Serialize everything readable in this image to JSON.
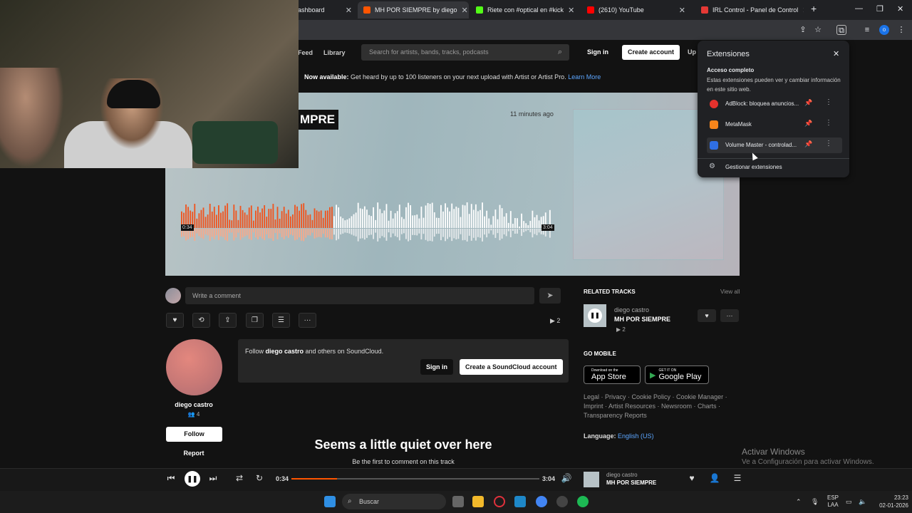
{
  "browser": {
    "tabs": [
      {
        "title": "ashboard",
        "fav": "#4a6ee0"
      },
      {
        "title": "MH POR SIEMPRE by diego",
        "fav": "#ff5500",
        "active": true
      },
      {
        "title": "Riete con #optical en #kick",
        "fav": "#53fc18"
      },
      {
        "title": "(2610) YouTube",
        "fav": "#ff0000"
      },
      {
        "title": "IRL Control - Panel de Control",
        "fav": "#e53935"
      }
    ]
  },
  "header": {
    "feed": "Feed",
    "library": "Library",
    "search_placeholder": "Search for artists, bands, tracks, podcasts",
    "sign_in": "Sign in",
    "create_account": "Create account",
    "upload": "Up"
  },
  "banner": {
    "bold": "Now available:",
    "text": " Get heard by up to 100 listeners on your next upload with Artist or Artist Pro. ",
    "link": "Learn More"
  },
  "track": {
    "title_fragment": "MPRE",
    "posted": "11 minutes ago",
    "elapsed": "0:34",
    "duration": "3:04",
    "progress": 0.185,
    "plays": "2"
  },
  "comment": {
    "placeholder": "Write a comment"
  },
  "artist": {
    "name": "diego castro",
    "followers": "4",
    "follow": "Follow",
    "report": "Report"
  },
  "followbox": {
    "prefix": "Follow ",
    "name": "diego castro",
    "suffix": " and others on SoundCloud.",
    "sign_in": "Sign in",
    "create": "Create a SoundCloud account"
  },
  "empty": {
    "title": "Seems a little quiet over here",
    "subtitle": "Be the first to comment on this track"
  },
  "related": {
    "heading": "RELATED TRACKS",
    "view_all": "View all",
    "artist": "diego castro",
    "title": "MH POR SIEMPRE",
    "plays": "2"
  },
  "mobile": {
    "heading": "GO MOBILE",
    "app_store_small": "Download on the",
    "app_store": "App Store",
    "google_small": "GET IT ON",
    "google": "Google Play"
  },
  "footer": {
    "legal_line1": "Legal · Privacy · Cookie Policy · Cookie Manager ·",
    "legal_line2": "Imprint · Artist Resources · Newsroom · Charts ·",
    "legal_line3": "Transparency Reports",
    "language_label": "Language:",
    "language": "English (US)"
  },
  "extensions": {
    "title": "Extensiones",
    "section": "Acceso completo",
    "description": "Estas extensiones pueden ver y cambiar información en este sitio web.",
    "items": [
      {
        "name": "AdBlock: bloquea anuncios...",
        "color": "#e5322d"
      },
      {
        "name": "MetaMask",
        "color": "#f6851b"
      },
      {
        "name": "Volume Master - controlad...",
        "color": "#2f6fe4"
      }
    ],
    "manage": "Gestionar extensiones"
  },
  "player": {
    "elapsed": "0:34",
    "duration": "3:04",
    "progress": 0.185,
    "artist": "diego castro",
    "title": "MH POR SIEMPRE"
  },
  "windows": {
    "activate_title": "Activar Windows",
    "activate_sub": "Ve a Configuración para activar Windows.",
    "search": "Buscar",
    "lang1": "ESP",
    "lang2": "LAA",
    "time": "23:23",
    "date": "02-01-2026"
  }
}
